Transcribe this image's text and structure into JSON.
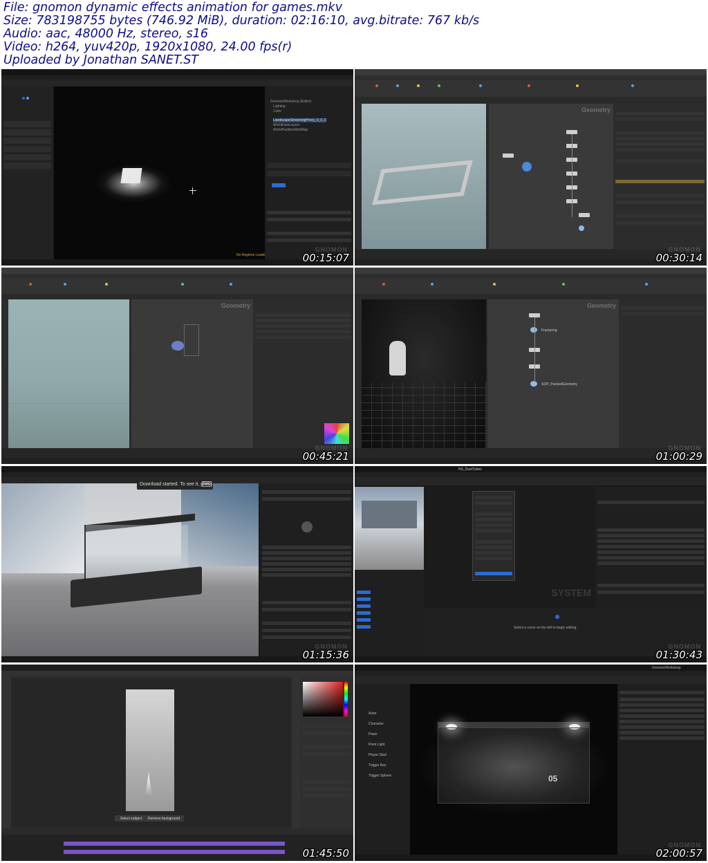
{
  "header": {
    "lines": [
      "File: gnomon dynamic effects animation for games.mkv",
      "Size: 783198755 bytes (746.92 MiB), duration: 02:16:10, avg.bitrate: 767 kb/s",
      "Audio: aac, 48000 Hz, stereo, s16",
      "Video: h264, yuv420p, 1920x1080, 24.00 fps(r)",
      "Uploaded by Jonathan SANET.ST"
    ]
  },
  "thumbnails": [
    {
      "timestamp": "00:15:07",
      "app": "Unreal Editor",
      "status": "No Regions Loaded",
      "outliner_items": [
        "GnomonWorkshop (Editor)",
        "Lighting",
        "Cube",
        "LandscapeStreamingProxy_0_0_0",
        "WorldDataLayers",
        "WorldPartitionMiniMap"
      ]
    },
    {
      "timestamp": "00:30:14",
      "app": "Houdini Indie",
      "network_label": "Geometry"
    },
    {
      "timestamp": "00:45:21",
      "app": "Houdini Indie",
      "network_label": "Geometry"
    },
    {
      "timestamp": "01:00:29",
      "app": "Houdini Indie",
      "network_label": "Geometry",
      "nodes": [
        "Fracturing",
        "SOP_PackedGeometry"
      ]
    },
    {
      "timestamp": "01:15:36",
      "app": "Unreal Editor",
      "notice": "Download started. To see it, press",
      "notice_key": "Esc"
    },
    {
      "timestamp": "01:30:43",
      "app": "Niagara Editor",
      "asset_name": "NS_DustTubes",
      "graph_label": "SYSTEM",
      "hint": "Select a curve on the left to begin editing."
    },
    {
      "timestamp": "01:45:50",
      "app": "Photoshop",
      "buttons": [
        "Select subject",
        "Remove background"
      ]
    },
    {
      "timestamp": "02:00:57",
      "app": "Unreal Editor",
      "title": "GnomonWorkshop",
      "place_actors": [
        "Actor",
        "Character",
        "Pawn",
        "Point Light",
        "Player Start",
        "Trigger Box",
        "Trigger Sphere"
      ],
      "sign": "05"
    }
  ],
  "watermark": "GNOMON",
  "colors": {
    "header_text": "#0d0d8a",
    "ui_dark": "#1a1a1a",
    "ue_blue": "#2b6cd4",
    "houdini_viewport": "#8fa5a8"
  }
}
